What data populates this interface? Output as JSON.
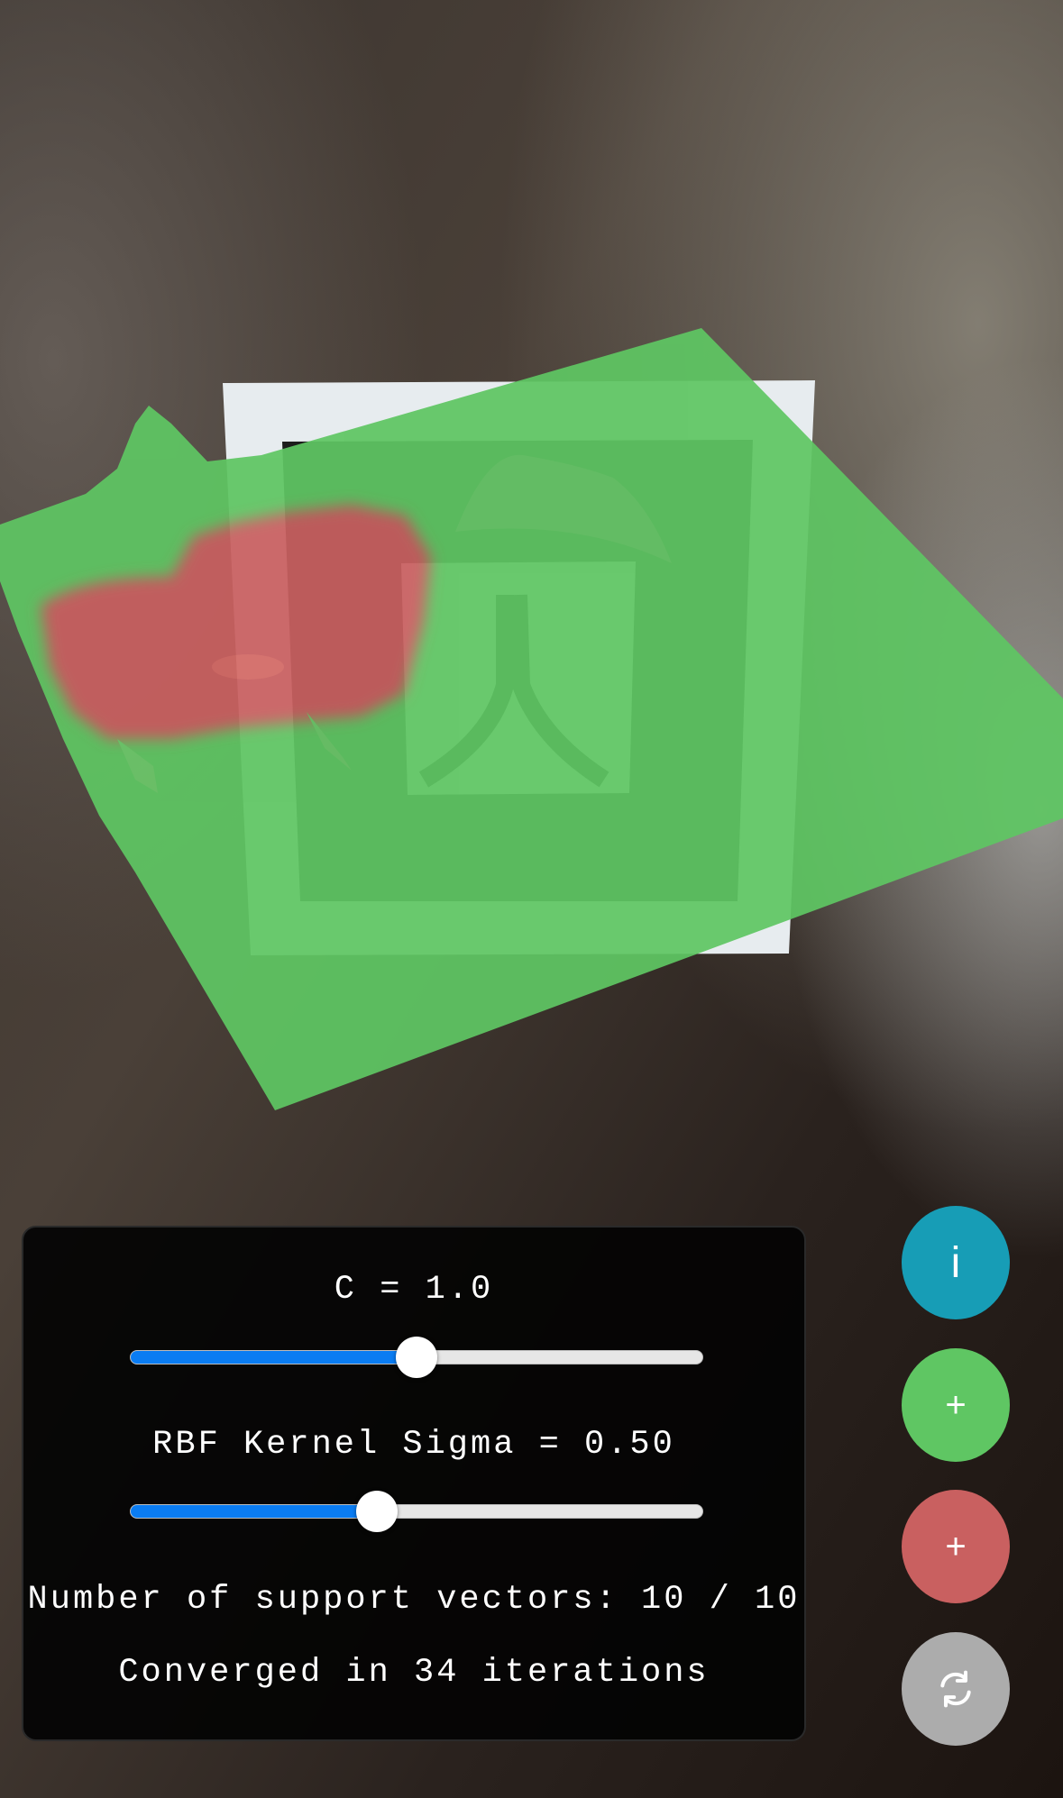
{
  "panel": {
    "c_label": "C = 1.0",
    "c_value": 0.5,
    "sigma_label": "RBF Kernel Sigma = 0.50",
    "sigma_value": 0.43,
    "support_vectors_text": "Number of support vectors: 10 / 10",
    "converged_text": "Converged in 34 iterations"
  },
  "buttons": {
    "info_label": "i",
    "add_green_label": "+",
    "add_red_label": "+",
    "reset_icon": "refresh-icon"
  },
  "colors": {
    "class_positive": "#5fc663",
    "class_negative": "#c96060",
    "info": "#179db6",
    "reset": "#acacac",
    "slider_fill": "#0a7cf2"
  }
}
